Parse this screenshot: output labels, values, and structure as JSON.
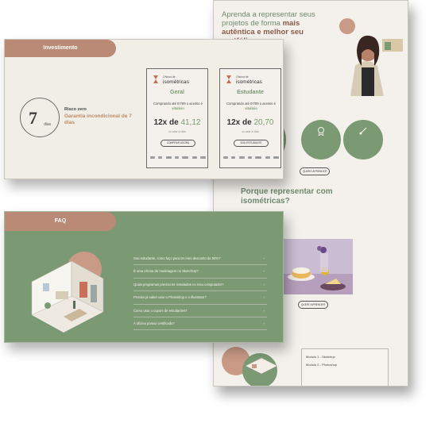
{
  "landing": {
    "hero_title_plain": "Aprenda a representar seus projetos de forma ",
    "hero_title_bold": "mais autêntica e melhor seu portfólio",
    "why_title": "Porque representar com isométricas?",
    "learn_button": "QUERO APRENDER",
    "modules": [
      {
        "title": "Modulo 1 - Sketchup"
      },
      {
        "title": "Modulo 2 - Photoshop"
      }
    ]
  },
  "investment": {
    "tab_label": "Investimento",
    "days_number": "7",
    "days_word": "dias",
    "risk_label": "Risco zero",
    "guarantee": "Garantia incondicional de 7 dias",
    "plans": [
      {
        "oficina": "Oficina de",
        "course": "isométricas",
        "plan": "Geral",
        "condition_prefix": "Comprando até 07/09 o acesso é",
        "condition_highlight": "vitalício",
        "installments": "12x de",
        "amount": "41,12",
        "cash_note": "ou valor à vista",
        "button": "COMPRAR AGORA"
      },
      {
        "oficina": "Oficina de",
        "course": "isométricas",
        "plan": "Estudante",
        "condition_prefix": "Comprando até 07/09 o acesso é",
        "condition_highlight": "vitalício",
        "installments": "12x de",
        "amount": "20,70",
        "cash_note": "ou valor à vista",
        "button": "SOU ESTUDANTE"
      }
    ]
  },
  "faq": {
    "tab_label": "FAQ",
    "questions": [
      "Sou estudante, como faço para ter meu desconto de 50%?",
      "É uma oficina de modelagem no SketchUp?",
      "Quais programas preciso ter instalados no meu computador?",
      "Preciso já saber usar o Photoshop e o Illustrator?",
      "Como usar o cupom de estudantes?",
      "A oficina possui certificado?"
    ]
  },
  "colors": {
    "sage": "#7b9a74",
    "terracotta": "#b98b76",
    "cream": "#f1eee8"
  }
}
